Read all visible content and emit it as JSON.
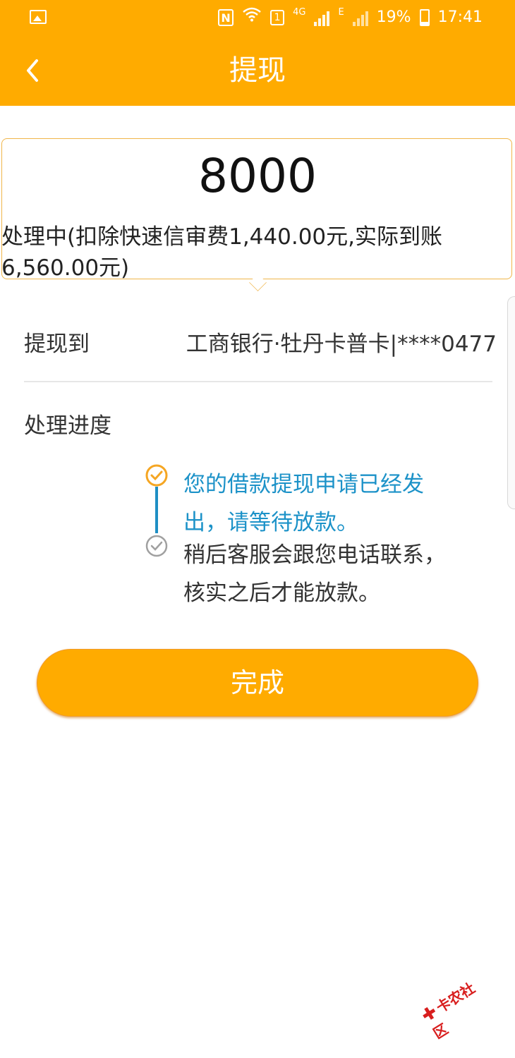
{
  "status_bar": {
    "network_4g": "4G",
    "network_e": "E",
    "battery": "19%",
    "time": "17:41",
    "wifi_badge": "1",
    "nfc": "N"
  },
  "header": {
    "title": "提现"
  },
  "summary": {
    "amount": "8000",
    "status_text": "处理中(扣除快速信审费1,440.00元,实际到账6,560.00元)"
  },
  "withdraw_to": {
    "label": "提现到",
    "bank": "工商银行·牡丹卡普卡|****0477"
  },
  "progress": {
    "label": "处理进度",
    "steps": [
      {
        "text": "您的借款提现申请已经发出，请等待放款。",
        "state": "done"
      },
      {
        "text": "稍后客服会跟您电话联系，核实之后才能放款。",
        "state": "pending"
      }
    ]
  },
  "done_button": {
    "label": "完成"
  },
  "watermark": {
    "text": "卡农社区"
  },
  "colors": {
    "accent": "#ffab00",
    "progress_blue": "#1c92c8",
    "card_border": "#f0b54a"
  }
}
